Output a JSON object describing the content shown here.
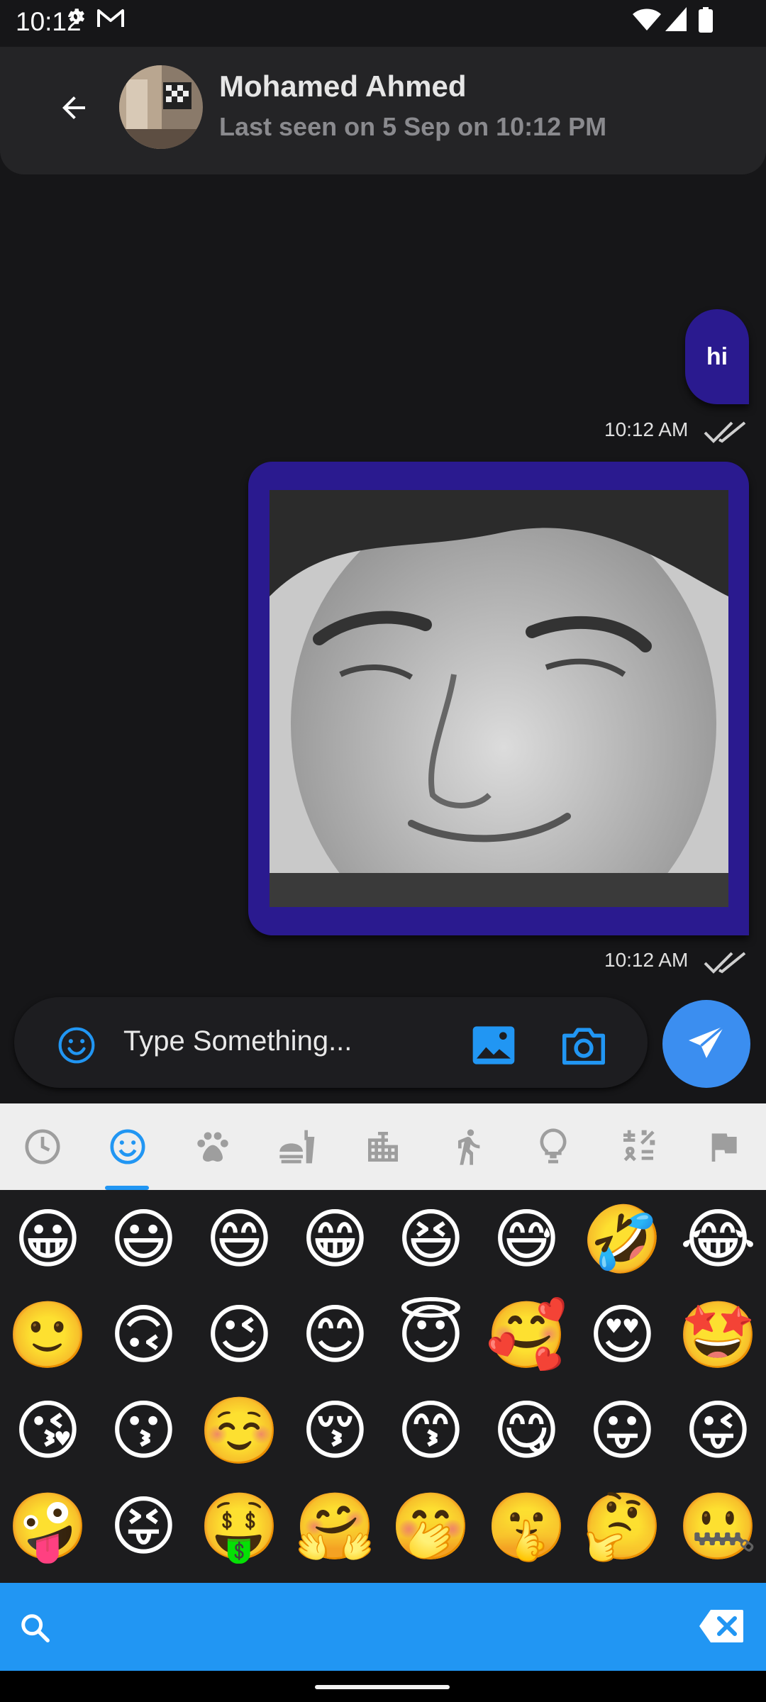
{
  "status_bar": {
    "time": "10:12"
  },
  "header": {
    "contact_name": "Mohamed Ahmed",
    "last_seen": "Last seen on 5 Sep on 10:12 PM"
  },
  "messages": [
    {
      "type": "text",
      "text": "hi",
      "time": "10:12 AM"
    },
    {
      "type": "image",
      "time": "10:12 AM"
    }
  ],
  "input": {
    "placeholder": "Type Something..."
  },
  "emoji_keyboard": {
    "categories": [
      "recent-icon",
      "smileys-icon",
      "animals-icon",
      "food-icon",
      "travel-icon",
      "activities-icon",
      "objects-icon",
      "symbols-icon",
      "flags-icon"
    ],
    "selected_category": "smileys",
    "emojis": [
      "😀",
      "😃",
      "😄",
      "😁",
      "😆",
      "😅",
      "🤣",
      "😂",
      "🙂",
      "🙃",
      "😉",
      "😊",
      "😇",
      "🥰",
      "😍",
      "🤩",
      "😘",
      "😗",
      "☺️",
      "😚",
      "😙",
      "😋",
      "😛",
      "😜",
      "🤪",
      "😝",
      "🤑",
      "🤗",
      "🤭",
      "🤫",
      "🤔",
      "🤐"
    ]
  },
  "colors": {
    "accent": "#2196f3",
    "bubble": "#2a1a8f",
    "send": "#3b8ef0"
  }
}
